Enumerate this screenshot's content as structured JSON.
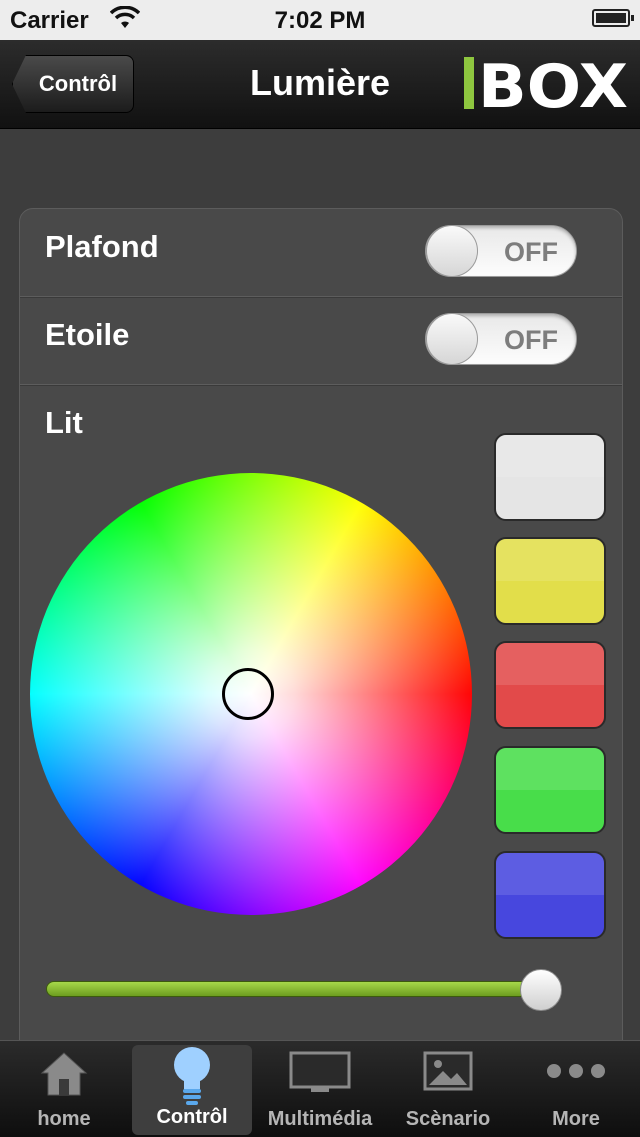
{
  "status_bar": {
    "carrier": "Carrier",
    "time": "7:02 PM"
  },
  "nav": {
    "back_label": "Contrôl",
    "title": "Lumière",
    "logo_text": "BOX"
  },
  "rows": [
    {
      "label": "Plafond",
      "toggle": "OFF",
      "state": "off"
    },
    {
      "label": "Etoile",
      "toggle": "OFF",
      "state": "off"
    }
  ],
  "lit": {
    "label": "Lit",
    "presets": [
      "#e5e5e5",
      "#e2de4a",
      "#e24a4a",
      "#48dd4a",
      "#4747de"
    ],
    "brightness_level": 0.97
  },
  "tabs": [
    {
      "label": "home",
      "icon": "house-icon",
      "active": false
    },
    {
      "label": "Contrôl",
      "icon": "lightbulb-icon",
      "active": true
    },
    {
      "label": "Multimédia",
      "icon": "monitor-icon",
      "active": false
    },
    {
      "label": "Scènario",
      "icon": "picture-icon",
      "active": false
    },
    {
      "label": "More",
      "icon": "more-dots-icon",
      "active": false
    }
  ],
  "colors": {
    "accent_green": "#8ec63f",
    "panel_bg": "#494949"
  }
}
